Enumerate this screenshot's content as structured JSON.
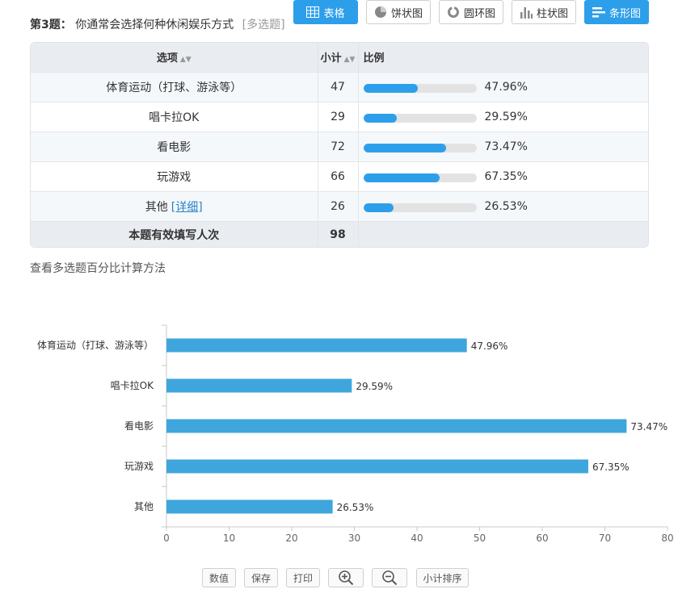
{
  "question": {
    "number_label": "第3题：",
    "text": "你通常会选择何种休闲娱乐方式",
    "type_label": "[多选题]"
  },
  "table": {
    "headers": {
      "option": "选项",
      "count": "小计",
      "ratio": "比例"
    },
    "rows": [
      {
        "option": "体育运动（打球、游泳等）",
        "count": "47",
        "percent": "47.96%",
        "fraction": 0.4796
      },
      {
        "option": "唱卡拉OK",
        "count": "29",
        "percent": "29.59%",
        "fraction": 0.2959
      },
      {
        "option": "看电影",
        "count": "72",
        "percent": "73.47%",
        "fraction": 0.7347
      },
      {
        "option": "玩游戏",
        "count": "66",
        "percent": "67.35%",
        "fraction": 0.6735
      },
      {
        "option": "其他",
        "detail_link": "[详细]",
        "count": "26",
        "percent": "26.53%",
        "fraction": 0.2653
      }
    ],
    "total": {
      "label": "本题有效填写人次",
      "value": "98"
    }
  },
  "method_link": "查看多选题百分比计算方法",
  "view_buttons": [
    {
      "label": "表格",
      "icon": "table-icon",
      "active": true
    },
    {
      "label": "饼状图",
      "icon": "pie-icon",
      "active": false
    },
    {
      "label": "圆环图",
      "icon": "ring-icon",
      "active": false
    },
    {
      "label": "柱状图",
      "icon": "column-icon",
      "active": false
    },
    {
      "label": "条形图",
      "icon": "bar-icon",
      "active": true
    }
  ],
  "toolbar": {
    "value_label": "数值",
    "save_label": "保存",
    "print_label": "打印",
    "zoom_in_icon": "zoom-in-icon",
    "zoom_out_icon": "zoom-out-icon",
    "sort_label": "小计排序"
  },
  "colors": {
    "accent": "#2d9fea",
    "bar": "#3ea6dc",
    "track": "#e3e3e3"
  },
  "chart_data": {
    "type": "bar",
    "orientation": "horizontal",
    "categories": [
      "体育运动（打球、游泳等）",
      "唱卡拉OK",
      "看电影",
      "玩游戏",
      "其他"
    ],
    "values": [
      47.96,
      29.59,
      73.47,
      67.35,
      26.53
    ],
    "value_labels": [
      "47.96%",
      "29.59%",
      "73.47%",
      "67.35%",
      "26.53%"
    ],
    "x_ticks": [
      0,
      10,
      20,
      30,
      40,
      50,
      60,
      70,
      80
    ],
    "xlim": [
      0,
      80
    ],
    "grid": false
  }
}
